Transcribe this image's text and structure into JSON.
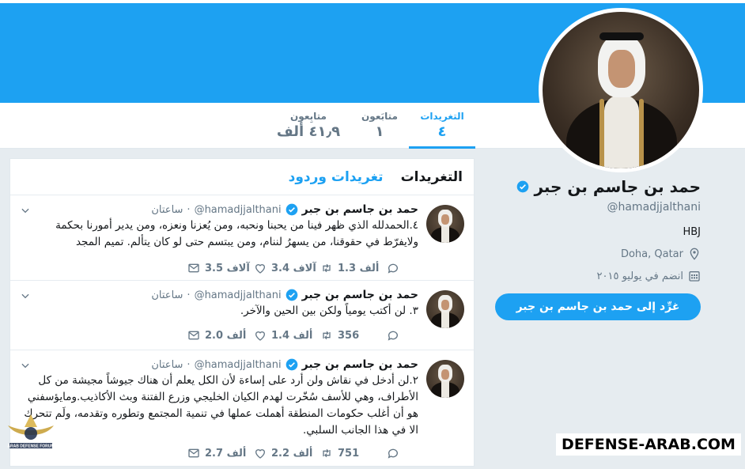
{
  "header": {
    "banner_color": "#1da1f2"
  },
  "nav": {
    "tweets_label": "التغريدات",
    "tweets_count": "٤",
    "following_label": "متابَعون",
    "following_count": "١",
    "followers_label": "متابِعون",
    "followers_count": "٤١٫٩ ألف"
  },
  "profile": {
    "name": "حمد بن جاسم بن جبر",
    "handle": "@hamadjjalthani",
    "bio": "HBJ",
    "location": "Doha, Qatar",
    "joined": "انضم في يوليو ٢٠١٥",
    "dm_button": "غرِّد إلى حمد بن جاسم بن جبر",
    "location_icon": "location-pin-icon",
    "calendar_icon": "calendar-icon"
  },
  "timeline": {
    "tab_tweets": "التغريدات",
    "tab_replies": "تغريدات وردود",
    "tweets": [
      {
        "name": "حمد بن جاسم بن جبر",
        "handle": "@hamadjjalthani",
        "time": "ساعتان",
        "text": "٤.الحمدلله الذي ظهر فينا من يحبنا ونحبه، ومن يُعزنا ونعزه، ومن يدير أمورنا بحكمة ولايفرّط في حقوقنا، من يسهرُ لننام، ومن يبتسم حتى لو كان يتألم. تميم المجد",
        "replies": "1.3 ألف",
        "retweets": "3.4 آلاف",
        "likes": "3.5 آلاف"
      },
      {
        "name": "حمد بن جاسم بن جبر",
        "handle": "@hamadjjalthani",
        "time": "ساعتان",
        "text": "٣. لن أكتب يومياً ولكن بين الحين والآخر.",
        "replies": "356",
        "retweets": "1.4 ألف",
        "likes": "2.0 ألف"
      },
      {
        "name": "حمد بن جاسم بن جبر",
        "handle": "@hamadjjalthani",
        "time": "ساعتان",
        "text": "٢.لن أدخل في نقاش ولن أرد على إساءة لأن الكل يعلم أن هناك جيوشاً مجيشة من كل الأطراف، وهي للأسف سُخّرت لهدم الكيان الخليجي وزرع الفتنة وبث الأكاذيب.ومايؤسفني هو أن أغلب حكومات المنطقة أهملت عملها في تنمية المجتمع وتطوره وتقدمه، ولَم تتحرك الا في هذا الجانب السلبي.",
        "replies": "751",
        "retweets": "2.2 ألف",
        "likes": "2.7 ألف"
      }
    ]
  },
  "watermark": {
    "text": "DEFENSE-ARAB.COM",
    "logo_text": "ARAB DEFENSE FORUM"
  }
}
